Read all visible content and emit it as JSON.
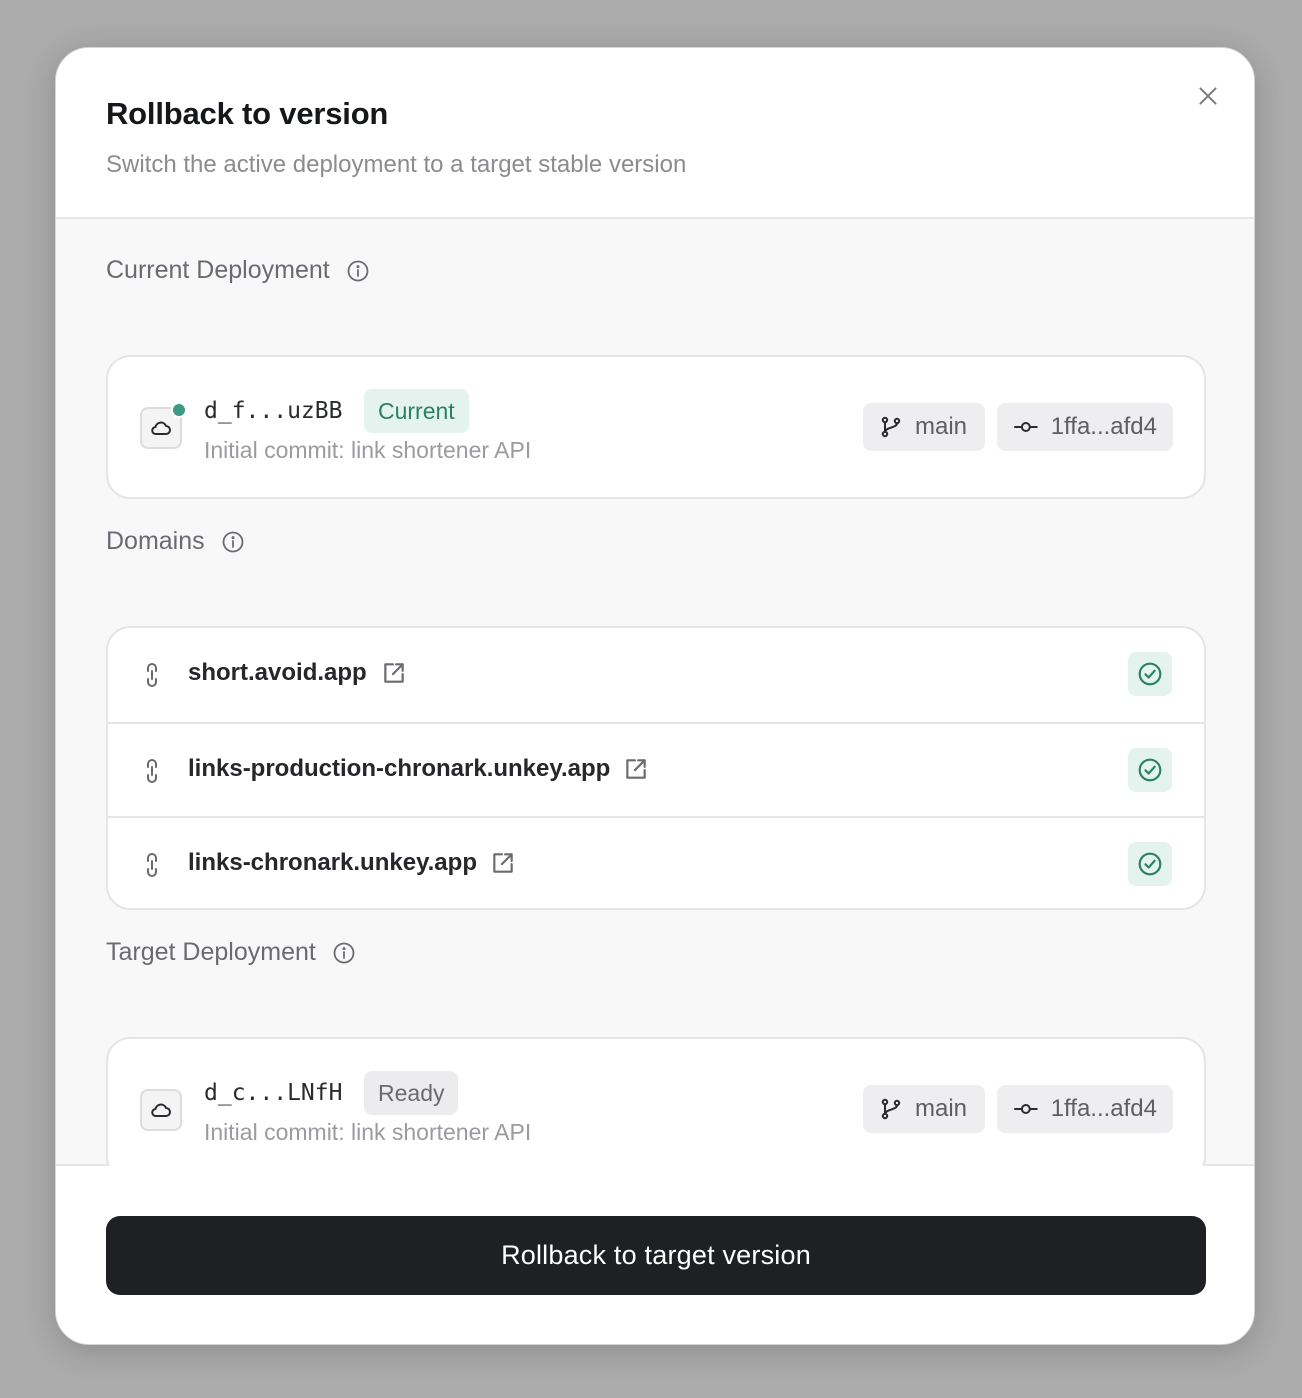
{
  "dialog": {
    "title": "Rollback to version",
    "subtitle": "Switch the active deployment to a target stable version",
    "close_icon": "close-icon"
  },
  "current": {
    "label": "Current Deployment",
    "id": "d_f...uzBB",
    "badge": "Current",
    "message": "Initial commit: link shortener API",
    "branch": "main",
    "commit": "1ffa...afd4",
    "status_color": "#3c9a82"
  },
  "domains": {
    "label": "Domains",
    "items": [
      {
        "name": "short.avoid.app"
      },
      {
        "name": "links-production-chronark.unkey.app"
      },
      {
        "name": "links-chronark.unkey.app"
      }
    ]
  },
  "target": {
    "label": "Target Deployment",
    "id": "d_c...LNfH",
    "badge": "Ready",
    "message": "Initial commit: link shortener API",
    "branch": "main",
    "commit": "1ffa...afd4"
  },
  "footer": {
    "primary_label": "Rollback to target version"
  },
  "colors": {
    "accent_green": "#2c8066",
    "primary_button": "#1e2024"
  }
}
